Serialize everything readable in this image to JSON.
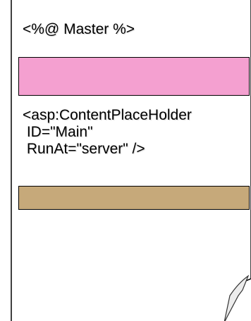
{
  "master_directive": "<%@ Master %>",
  "content_placeholder": {
    "line1": "<asp:ContentPlaceHolder",
    "line2": " ID=\"Main\"",
    "line3": " RunAt=\"server\" />"
  },
  "colors": {
    "page_fill": "#ffffff",
    "page_border": "#000000",
    "pink_block": "#f4a0d0",
    "tan_block": "#c6a97a",
    "fold_fill": "#ececec"
  }
}
